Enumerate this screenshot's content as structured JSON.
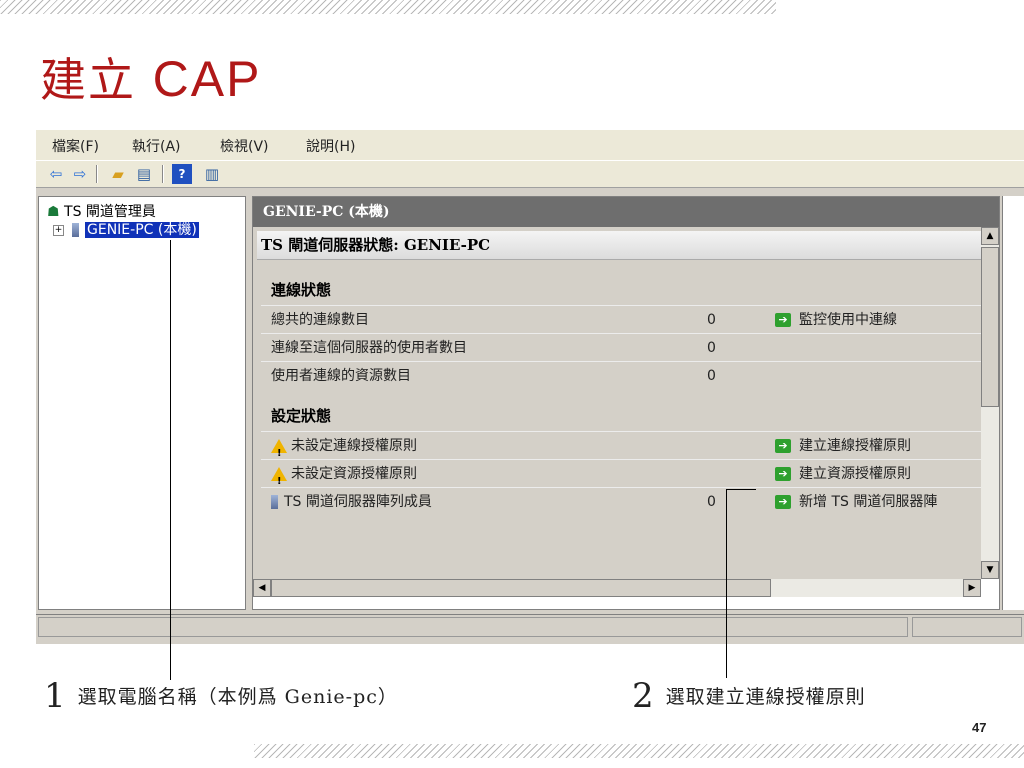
{
  "slide": {
    "title_cjk": "建立",
    "title_latin": "CAP",
    "page_number": "47"
  },
  "menu": [
    "檔案(F)",
    "執行(A)",
    "檢視(V)",
    "說明(H)"
  ],
  "toolbar_icons": [
    "back-arrow-icon",
    "forward-arrow-icon",
    "up-folder-icon",
    "show-pane-icon",
    "help-icon",
    "action-pane-icon"
  ],
  "tree": {
    "root": "TS 閘道管理員",
    "child": "GENIE-PC (本機)"
  },
  "detail": {
    "header": "GENIE-PC (本機)",
    "panel_title": "TS 閘道伺服器狀態: GENIE-PC",
    "section_connection": "連線狀態",
    "section_config": "設定狀態",
    "rows": [
      {
        "label": "總共的連線數目",
        "count": "0",
        "action": "監控使用中連線"
      },
      {
        "label": "連線至這個伺服器的使用者數目",
        "count": "0",
        "action": ""
      },
      {
        "label": "使用者連線的資源數目",
        "count": "0",
        "action": ""
      },
      {
        "label": "未設定連線授權原則",
        "count": "",
        "action": "建立連線授權原則"
      },
      {
        "label": "未設定資源授權原則",
        "count": "",
        "action": "建立資源授權原則"
      },
      {
        "label": "TS 閘道伺服器陣列成員",
        "count": "0",
        "action": "新增 TS 閘道伺服器陣"
      }
    ]
  },
  "captions": {
    "step1_num": "1",
    "step1_text": "選取電腦名稱（本例爲 Genie-pc）",
    "step2_num": "2",
    "step2_text": "選取建立連線授權原則"
  },
  "colors": {
    "title_red": "#b01818",
    "selection_blue": "#1032b8",
    "action_green": "#2ea02e",
    "warning_yellow": "#f0b400"
  }
}
